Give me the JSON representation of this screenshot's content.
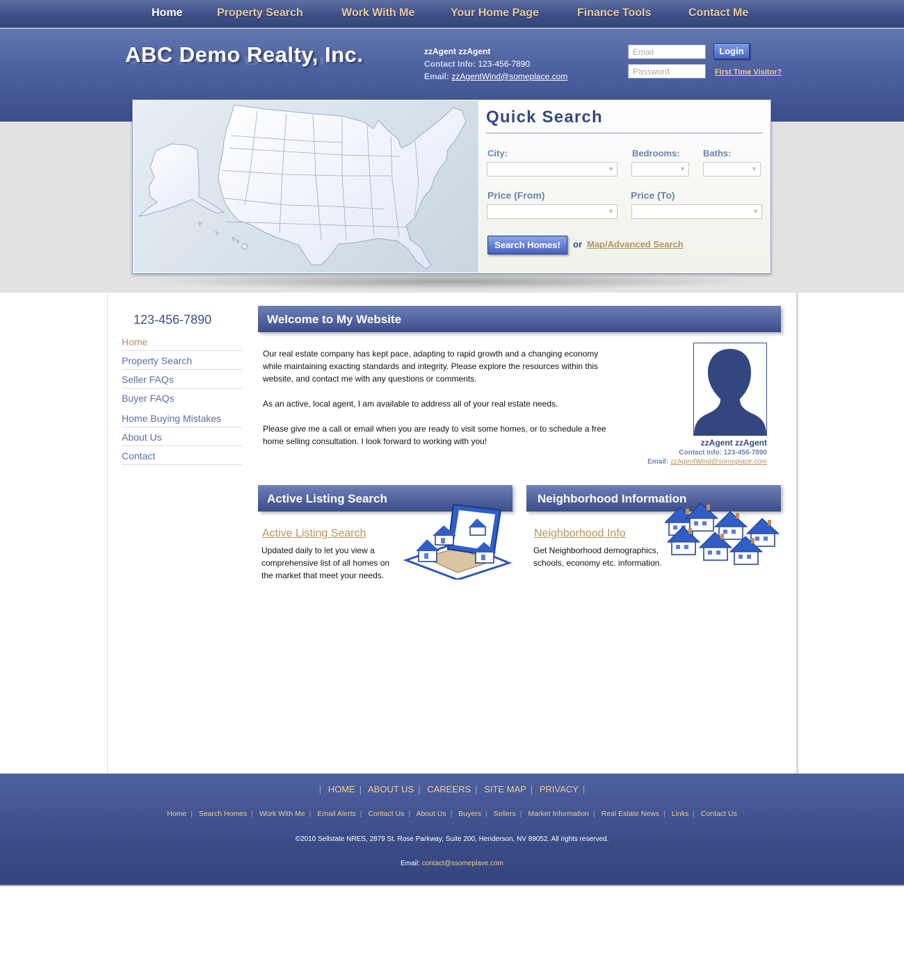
{
  "nav": {
    "items": [
      "Home",
      "Property Search",
      "Work With Me",
      "Your Home Page",
      "Finance Tools",
      "Contact Me"
    ],
    "active": "Home"
  },
  "header": {
    "logo": "ABC Demo Realty, Inc.",
    "agent_name": "zzAgent zzAgent",
    "contact_label": "Contact Info:",
    "contact_phone": "123-456-7890",
    "email_label": "Email:",
    "email": "zzAgentWind@someplace.com",
    "login": {
      "email_placeholder": "Email",
      "password_placeholder": "Password",
      "button": "Login",
      "first_time": "First Time Visitor?"
    }
  },
  "quick_search": {
    "title": "Quick Search",
    "city_label": "City:",
    "bedrooms_label": "Bedrooms:",
    "baths_label": "Baths:",
    "price_from_label": "Price (From)",
    "price_to_label": "Price (To)",
    "button": "Search Homes!",
    "or": "or",
    "advanced_link": "Map/Advanced Search"
  },
  "sidebar": {
    "phone": "123-456-7890",
    "items": [
      "Home",
      "Property Search",
      "Seller FAQs",
      "Buyer FAQs",
      "Home Buying Mistakes",
      "About Us",
      "Contact"
    ],
    "active": "Home"
  },
  "welcome": {
    "heading": "Welcome to My Website",
    "paragraphs": [
      "Our real estate company has kept pace, adapting to rapid growth and a changing economy while maintaining exacting standards and integrity. Please explore the resources within this website, and contact me with any questions or comments.",
      "As an active, local agent, I am available to address all of your real estate needs.",
      "Please give me a call or email when you are ready to visit some homes, or to schedule a free home selling consultation. I look forward to working with you!"
    ],
    "agent_card": {
      "name": "zzAgent zzAgent",
      "contact_label": "Contact Info:",
      "contact_phone": "123-456-7890",
      "email_label": "Email:",
      "email": "zzAgentWind@someplace.com"
    }
  },
  "features": {
    "listing": {
      "heading": "Active Listing Search",
      "link": "Active Listing Search",
      "text": "Updated daily to let you view a comprehensive list of all homes on the market that meet your needs."
    },
    "neighborhood": {
      "heading": "Neighborhood Information",
      "link": "Neighborhood Info",
      "text": "Get Neighborhood demographics, schools, economy etc. information."
    }
  },
  "footer": {
    "main_links": [
      "HOME",
      "ABOUT US",
      "CAREERS",
      "SITE MAP",
      "PRIVACY"
    ],
    "sub_links": [
      "Home",
      "Search Homes",
      "Work With Me",
      "Email Alerts",
      "Contact Us",
      "About Us",
      "Buyers",
      "Sellers",
      "Market Information",
      "Real Estate News",
      "Links",
      "Contact Us"
    ],
    "copyright": "©2010 Sellstate NRES, 2879 St. Rose Parkway, Suite 200, Henderson, NV 89052. All rights reserved.",
    "email_label": "Email:",
    "email": "contact@ssomeplave.com"
  },
  "colors": {
    "primary_blue": "#3b4d89",
    "accent_tan": "#b69361",
    "nav_gold": "#e9c99a",
    "link_blue": "#5a6fa5"
  },
  "icons": {
    "us_map": "us-map-graphic",
    "agent_photo": "person-silhouette-icon",
    "listing_graphic": "house-listing-graphic",
    "neighborhood_graphic": "houses-cluster-graphic"
  }
}
